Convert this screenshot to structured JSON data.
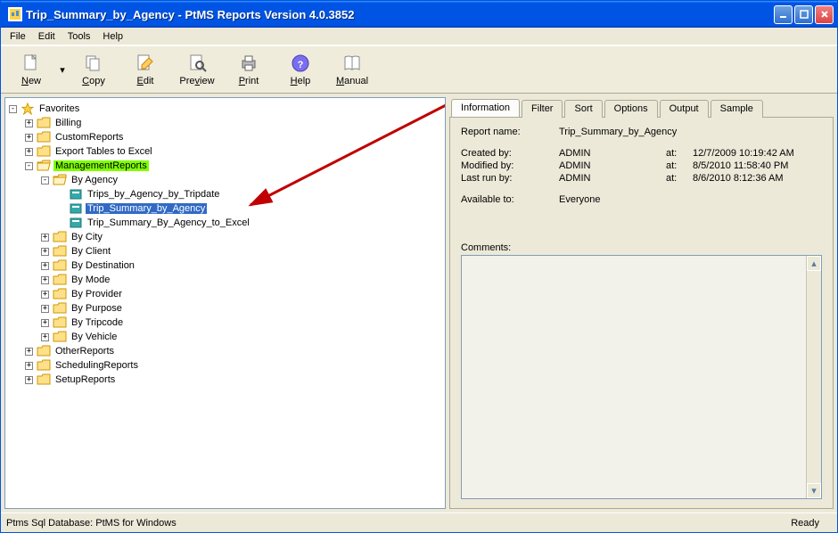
{
  "window": {
    "title": "Trip_Summary_by_Agency - PtMS Reports Version 4.0.3852"
  },
  "menu": {
    "file": "File",
    "edit": "Edit",
    "tools": "Tools",
    "help": "Help"
  },
  "toolbar": {
    "new": "New",
    "copy": "Copy",
    "edit": "Edit",
    "preview": "Preview",
    "print": "Print",
    "help": "Help",
    "manual": "Manual"
  },
  "tree": {
    "favorites": "Favorites",
    "billing": "Billing",
    "custom": "CustomReports",
    "export": "Export Tables to Excel",
    "mgmt": "ManagementReports",
    "byagency": "By Agency",
    "rpt1": "Trips_by_Agency_by_Tripdate",
    "rpt2": "Trip_Summary_by_Agency",
    "rpt3": "Trip_Summary_By_Agency_to_Excel",
    "bycity": "By City",
    "byclient": "By Client",
    "bydest": "By Destination",
    "bymode": "By Mode",
    "byprovider": "By Provider",
    "bypurpose": "By Purpose",
    "bytripcode": "By Tripcode",
    "byvehicle": "By Vehicle",
    "other": "OtherReports",
    "sched": "SchedulingReports",
    "setup": "SetupReports"
  },
  "tabs": {
    "info": "Information",
    "filter": "Filter",
    "sort": "Sort",
    "options": "Options",
    "output": "Output",
    "sample": "Sample"
  },
  "info": {
    "reportname_lbl": "Report name:",
    "reportname": "Trip_Summary_by_Agency",
    "created_lbl": "Created by:",
    "created_by": "ADMIN",
    "created_at_lbl": "at:",
    "created_at": "12/7/2009 10:19:42 AM",
    "modified_lbl": "Modified by:",
    "modified_by": "ADMIN",
    "modified_at_lbl": "at:",
    "modified_at": "8/5/2010 11:58:40 PM",
    "lastrun_lbl": "Last run by:",
    "lastrun_by": "ADMIN",
    "lastrun_at_lbl": "at:",
    "lastrun_at": "8/6/2010 8:12:36 AM",
    "avail_lbl": "Available to:",
    "avail": "Everyone",
    "comments_lbl": "Comments:"
  },
  "status": {
    "db": "Ptms Sql Database: PtMS for Windows",
    "ready": "Ready"
  }
}
